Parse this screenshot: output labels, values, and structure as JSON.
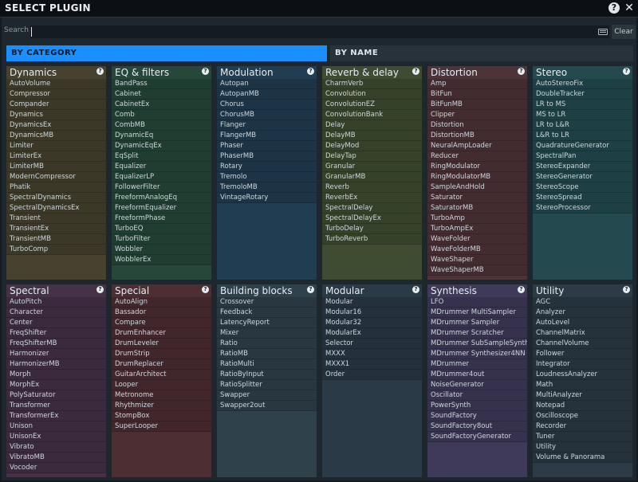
{
  "window": {
    "title": "SELECT PLUGIN",
    "help_icon": "?",
    "close_icon": "✕"
  },
  "search": {
    "label": "Search",
    "value": "",
    "clear_label": "Clear"
  },
  "tabs": [
    {
      "label": "BY CATEGORY",
      "active": true
    },
    {
      "label": "BY NAME",
      "active": false
    }
  ],
  "help_glyph": "?",
  "categories": [
    {
      "title": "Dynamics",
      "color": "#46422f",
      "items": [
        "AutoVolume",
        "Compressor",
        "Compander",
        "Dynamics",
        "DynamicsEx",
        "DynamicsMB",
        "Limiter",
        "LimiterEx",
        "LimiterMB",
        "ModernCompressor",
        "Phatik",
        "SpectralDynamics",
        "SpectralDynamicsEx",
        "Transient",
        "TransientEx",
        "TransientMB",
        "TurboComp"
      ]
    },
    {
      "title": "EQ & filters",
      "color": "#26473a",
      "items": [
        "BandPass",
        "Cabinet",
        "CabinetEx",
        "Comb",
        "CombMB",
        "DynamicEq",
        "DynamicEqEx",
        "EqSplit",
        "Equalizer",
        "EqualizerLP",
        "FollowerFilter",
        "FreeformAnalogEq",
        "FreeformEqualizer",
        "FreeformPhase",
        "TurboEQ",
        "TurboFilter",
        "Wobbler",
        "WobblerEx"
      ]
    },
    {
      "title": "Modulation",
      "color": "#213d52",
      "items": [
        "Autopan",
        "AutopanMB",
        "Chorus",
        "ChorusMB",
        "Flanger",
        "FlangerMB",
        "Phaser",
        "PhaserMB",
        "Rotary",
        "Tremolo",
        "TremoloMB",
        "VintageRotary"
      ]
    },
    {
      "title": "Reverb & delay",
      "color": "#3f4c31",
      "items": [
        "CharmVerb",
        "Convolution",
        "ConvolutionEZ",
        "ConvolutionBank",
        "Delay",
        "DelayMB",
        "DelayMod",
        "DelayTap",
        "Granular",
        "GranularMB",
        "Reverb",
        "ReverbEx",
        "SpectralDelay",
        "SpectralDelayEx",
        "TurboDelay",
        "TurboReverb"
      ]
    },
    {
      "title": "Distortion",
      "color": "#4d3438",
      "items": [
        "Amp",
        "BitFun",
        "BitFunMB",
        "Clipper",
        "Distortion",
        "DistortionMB",
        "NeuralAmpLoader",
        "Reducer",
        "RingModulator",
        "RingModulatorMB",
        "SampleAndHold",
        "Saturator",
        "SaturatorMB",
        "TurboAmp",
        "TurboAmpEx",
        "WaveFolder",
        "WaveFolderMB",
        "WaveShaper",
        "WaveShaperMB"
      ]
    },
    {
      "title": "Stereo",
      "color": "#244a4f",
      "items": [
        "AutoStereoFix",
        "DoubleTracker",
        "LR to MS",
        "MS to LR",
        "LR to L&R",
        "L&R to LR",
        "QuadratureGenerator",
        "SpectralPan",
        "StereoExpander",
        "StereoGenerator",
        "StereoScope",
        "StereoSpread",
        "StereoProcessor"
      ]
    },
    {
      "title": "Spectral",
      "color": "#453247",
      "items": [
        "AutoPitch",
        "Character",
        "Center",
        "FreqShifter",
        "FreqShifterMB",
        "Harmonizer",
        "HarmonizerMB",
        "Morph",
        "MorphEx",
        "PolySaturator",
        "Transformer",
        "TransformerEx",
        "Unison",
        "UnisonEx",
        "Vibrato",
        "VibratoMB",
        "Vocoder"
      ]
    },
    {
      "title": "Special",
      "color": "#4c2e33",
      "items": [
        "AutoAlign",
        "Bassador",
        "Compare",
        "DrumEnhancer",
        "DrumLeveler",
        "DrumStrip",
        "DrumReplacer",
        "GuitarArchitect",
        "Looper",
        "Metronome",
        "Rhythmizer",
        "StompBox",
        "SuperLooper"
      ]
    },
    {
      "title": "Building blocks",
      "color": "#2f414b",
      "items": [
        "Crossover",
        "Feedback",
        "LatencyReport",
        "Mixer",
        "Ratio",
        "RatioMB",
        "RatioMulti",
        "RatioByInput",
        "RatioSplitter",
        "Swapper",
        "Swapper2out"
      ]
    },
    {
      "title": "Modular",
      "color": "#2b3a47",
      "items": [
        "Modular",
        "Modular16",
        "Modular32",
        "ModularEx",
        "Selector",
        "MXXX",
        "MXXX1",
        "Order"
      ]
    },
    {
      "title": "Synthesis",
      "color": "#3f3a5a",
      "items": [
        "LFO",
        "MDrummer MultiSampler",
        "MDrummer Sampler",
        "MDrummer Scratcher",
        "MDrummer SubSampleSynth",
        "MDrummer Synthesizer4NN",
        "MDrummer",
        "MDrummer4out",
        "NoiseGenerator",
        "Oscillator",
        "PowerSynth",
        "SoundFactory",
        "SoundFactory8out",
        "SoundFactoryGenerator"
      ]
    },
    {
      "title": "Utility",
      "color": "#2c3b45",
      "items": [
        "AGC",
        "Analyzer",
        "AutoLevel",
        "ChannelMatrix",
        "ChannelVolume",
        "Follower",
        "Integrator",
        "LoudnessAnalyzer",
        "Math",
        "MultiAnalyzer",
        "Notepad",
        "Oscilloscope",
        "Recorder",
        "Tuner",
        "Utility",
        "Volume & Panorama"
      ]
    }
  ]
}
